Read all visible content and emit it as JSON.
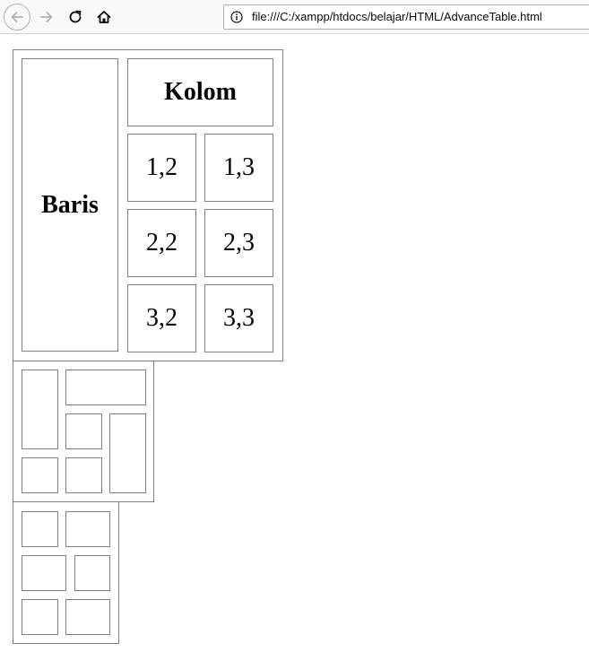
{
  "browser": {
    "url": "file:///C:/xampp/htdocs/belajar/HTML/AdvanceTable.html",
    "icons": [
      "back-arrow-icon",
      "forward-arrow-icon",
      "reload-icon",
      "home-icon",
      "info-icon"
    ]
  },
  "table1": {
    "row_header": "Baris",
    "col_header": "Kolom",
    "cells": [
      [
        "1,2",
        "1,3"
      ],
      [
        "2,2",
        "2,3"
      ],
      [
        "3,2",
        "3,3"
      ]
    ]
  },
  "colors": {
    "border": "#808080",
    "toolbar_bg": "#f9f9fa"
  }
}
